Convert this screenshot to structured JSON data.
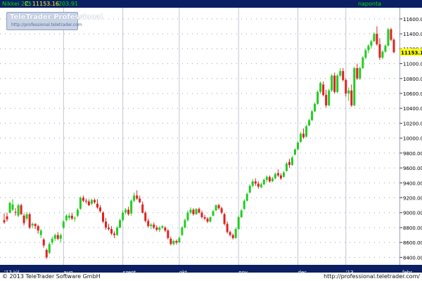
{
  "header": {
    "symbol": "Nikkei 225",
    "close_label": "C: 11153.16",
    "change": "203.91",
    "period": "naponta"
  },
  "logo": {
    "title": "TeleTrader Professional",
    "url": "http://professional.teletrader.com"
  },
  "footer": {
    "copyright": "© 2013 TeleTrader Software GmbH",
    "url": "http://professional.teletrader.com/"
  },
  "colors": {
    "up": "#22cc22",
    "down": "#e02020",
    "header_bg": "#0b1f63",
    "last_price_bg": "#ffff00"
  },
  "chart_data": {
    "type": "candlestick",
    "y_axis_position": "right",
    "ylim": [
      8300,
      11750
    ],
    "y_ticks": [
      8400,
      8600,
      8800,
      9000,
      9200,
      9400,
      9600,
      9800,
      10000,
      10200,
      10400,
      10600,
      10800,
      11000,
      11200,
      11400,
      11600
    ],
    "y_tick_labels": [
      "8400.00",
      "8600.00",
      "8800.00",
      "9000.00",
      "9200.00",
      "9400.00",
      "9600.00",
      "9800.00",
      "10000.00",
      "10200.00",
      "10400.00",
      "10600.00",
      "10800.00",
      "11000.00",
      "11200.00",
      "11400.00",
      "11600.00"
    ],
    "x_labels": [
      {
        "label": "'12 júl.",
        "index": 0
      },
      {
        "label": "aug.",
        "index": 21
      },
      {
        "label": "szept.",
        "index": 42
      },
      {
        "label": "okt.",
        "index": 62
      },
      {
        "label": "nov.",
        "index": 83
      },
      {
        "label": "dec.",
        "index": 104
      },
      {
        "label": "'13",
        "index": 121
      },
      {
        "label": "febr.",
        "index": 141
      }
    ],
    "last_price_label": "11153.16",
    "last_price": 11153.16,
    "candles": [
      [
        8900,
        8990,
        8850,
        8870
      ],
      [
        8950,
        9000,
        8880,
        8910
      ],
      [
        9000,
        9150,
        8990,
        9130
      ],
      [
        9040,
        9180,
        9020,
        9110
      ],
      [
        9010,
        9060,
        8960,
        9000
      ],
      [
        8960,
        9120,
        8940,
        9100
      ],
      [
        9100,
        9120,
        8970,
        8980
      ],
      [
        8960,
        8990,
        8830,
        8860
      ],
      [
        8920,
        9010,
        8890,
        8980
      ],
      [
        8980,
        9000,
        8780,
        8800
      ],
      [
        8830,
        8870,
        8790,
        8850
      ],
      [
        8850,
        8860,
        8780,
        8820
      ],
      [
        8820,
        8840,
        8720,
        8760
      ],
      [
        8700,
        8780,
        8660,
        8760
      ],
      [
        8640,
        8660,
        8530,
        8560
      ],
      [
        8500,
        8520,
        8380,
        8400
      ],
      [
        8460,
        8600,
        8440,
        8580
      ],
      [
        8600,
        8680,
        8570,
        8650
      ],
      [
        8650,
        8720,
        8620,
        8700
      ],
      [
        8700,
        8740,
        8630,
        8650
      ],
      [
        8650,
        8720,
        8600,
        8700
      ],
      [
        8800,
        8900,
        8780,
        8880
      ],
      [
        8900,
        8980,
        8880,
        8960
      ],
      [
        8930,
        8990,
        8900,
        8960
      ],
      [
        8960,
        9000,
        8900,
        8920
      ],
      [
        8920,
        8950,
        8880,
        8930
      ],
      [
        8960,
        9060,
        8940,
        9040
      ],
      [
        9050,
        9220,
        9040,
        9200
      ],
      [
        9200,
        9230,
        9140,
        9160
      ],
      [
        9160,
        9190,
        9120,
        9150
      ],
      [
        9150,
        9180,
        9090,
        9100
      ],
      [
        9120,
        9190,
        9100,
        9170
      ],
      [
        9170,
        9190,
        9120,
        9140
      ],
      [
        9120,
        9180,
        9050,
        9070
      ],
      [
        9070,
        9100,
        9000,
        9020
      ],
      [
        9000,
        9020,
        8860,
        8880
      ],
      [
        8880,
        8930,
        8770,
        8800
      ],
      [
        8800,
        8850,
        8760,
        8780
      ],
      [
        8780,
        8820,
        8700,
        8720
      ],
      [
        8720,
        8750,
        8660,
        8700
      ],
      [
        8700,
        8820,
        8690,
        8800
      ],
      [
        8800,
        8920,
        8790,
        8900
      ],
      [
        8900,
        9030,
        8880,
        9000
      ],
      [
        9000,
        9060,
        8980,
        9040
      ],
      [
        9040,
        9080,
        8960,
        8980
      ],
      [
        8990,
        9180,
        8960,
        9160
      ],
      [
        9160,
        9270,
        9140,
        9230
      ],
      [
        9230,
        9300,
        9170,
        9190
      ],
      [
        9190,
        9230,
        9130,
        9140
      ],
      [
        9110,
        9150,
        8990,
        9000
      ],
      [
        9000,
        9020,
        8870,
        8890
      ],
      [
        8890,
        8920,
        8800,
        8820
      ],
      [
        8820,
        8860,
        8780,
        8840
      ],
      [
        8840,
        8870,
        8780,
        8800
      ],
      [
        8800,
        8830,
        8750,
        8770
      ],
      [
        8770,
        8820,
        8740,
        8800
      ],
      [
        8800,
        8830,
        8780,
        8820
      ],
      [
        8800,
        8820,
        8740,
        8760
      ],
      [
        8760,
        8780,
        8640,
        8660
      ],
      [
        8650,
        8680,
        8560,
        8580
      ],
      [
        8580,
        8640,
        8560,
        8620
      ],
      [
        8620,
        8640,
        8570,
        8600
      ],
      [
        8600,
        8680,
        8590,
        8660
      ],
      [
        8700,
        8820,
        8690,
        8800
      ],
      [
        8800,
        8920,
        8790,
        8900
      ],
      [
        8900,
        9030,
        8880,
        9000
      ],
      [
        9000,
        9070,
        8980,
        9040
      ],
      [
        9040,
        9060,
        8960,
        8980
      ],
      [
        8980,
        9060,
        8970,
        9050
      ],
      [
        9050,
        9070,
        8990,
        9000
      ],
      [
        9000,
        9030,
        8920,
        8940
      ],
      [
        8940,
        8970,
        8900,
        8920
      ],
      [
        8920,
        8940,
        8860,
        8880
      ],
      [
        8880,
        8950,
        8870,
        8940
      ],
      [
        8960,
        9040,
        8950,
        9020
      ],
      [
        9030,
        9110,
        9020,
        9100
      ],
      [
        9100,
        9120,
        9040,
        9060
      ],
      [
        9060,
        9080,
        8980,
        9000
      ],
      [
        8980,
        9000,
        8830,
        8850
      ],
      [
        8850,
        8880,
        8720,
        8740
      ],
      [
        8740,
        8760,
        8680,
        8700
      ],
      [
        8700,
        8720,
        8640,
        8660
      ],
      [
        8660,
        8800,
        8650,
        8780
      ],
      [
        8780,
        8960,
        8770,
        8940
      ],
      [
        8940,
        9050,
        8930,
        9030
      ],
      [
        9050,
        9180,
        9040,
        9160
      ],
      [
        9160,
        9270,
        9150,
        9250
      ],
      [
        9270,
        9380,
        9260,
        9360
      ],
      [
        9360,
        9450,
        9340,
        9420
      ],
      [
        9420,
        9460,
        9360,
        9390
      ],
      [
        9390,
        9420,
        9320,
        9350
      ],
      [
        9340,
        9400,
        9330,
        9380
      ],
      [
        9380,
        9460,
        9370,
        9440
      ],
      [
        9440,
        9500,
        9410,
        9480
      ],
      [
        9480,
        9500,
        9400,
        9420
      ],
      [
        9420,
        9480,
        9410,
        9460
      ],
      [
        9460,
        9540,
        9450,
        9520
      ],
      [
        9530,
        9580,
        9480,
        9500
      ],
      [
        9500,
        9530,
        9440,
        9460
      ],
      [
        9480,
        9560,
        9470,
        9540
      ],
      [
        9560,
        9680,
        9550,
        9660
      ],
      [
        9680,
        9720,
        9600,
        9640
      ],
      [
        9640,
        9760,
        9630,
        9740
      ],
      [
        9780,
        9860,
        9770,
        9850
      ],
      [
        9850,
        9960,
        9840,
        9940
      ],
      [
        9950,
        10080,
        9940,
        10060
      ],
      [
        10060,
        10130,
        9990,
        10010
      ],
      [
        10020,
        10180,
        10010,
        10160
      ],
      [
        10170,
        10260,
        10160,
        10240
      ],
      [
        10240,
        10380,
        10230,
        10360
      ],
      [
        10360,
        10480,
        10350,
        10460
      ],
      [
        10460,
        10640,
        10450,
        10620
      ],
      [
        10620,
        10760,
        10600,
        10740
      ],
      [
        10720,
        10760,
        10560,
        10580
      ],
      [
        10580,
        10650,
        10410,
        10440
      ],
      [
        10440,
        10660,
        10430,
        10640
      ],
      [
        10640,
        10860,
        10620,
        10840
      ],
      [
        10840,
        10880,
        10600,
        10620
      ],
      [
        10620,
        10860,
        10600,
        10840
      ],
      [
        10840,
        10940,
        10820,
        10900
      ],
      [
        10900,
        10940,
        10760,
        10780
      ],
      [
        10780,
        10800,
        10560,
        10600
      ],
      [
        10600,
        10680,
        10500,
        10640
      ],
      [
        10640,
        10720,
        10420,
        10440
      ],
      [
        10440,
        10960,
        10430,
        10940
      ],
      [
        10940,
        11000,
        10780,
        10800
      ],
      [
        10800,
        10960,
        10780,
        10940
      ],
      [
        10940,
        11100,
        10930,
        11080
      ],
      [
        11080,
        11200,
        11060,
        11180
      ],
      [
        11180,
        11260,
        11140,
        11240
      ],
      [
        11240,
        11320,
        11200,
        11300
      ],
      [
        11300,
        11420,
        11290,
        11400
      ],
      [
        11400,
        11500,
        11240,
        11260
      ],
      [
        11260,
        11340,
        11050,
        11080
      ],
      [
        11080,
        11180,
        11060,
        11160
      ],
      [
        11160,
        11260,
        11150,
        11240
      ],
      [
        11240,
        11480,
        11230,
        11460
      ],
      [
        11460,
        11480,
        11300,
        11320
      ],
      [
        11320,
        11340,
        11140,
        11153.16
      ]
    ]
  }
}
